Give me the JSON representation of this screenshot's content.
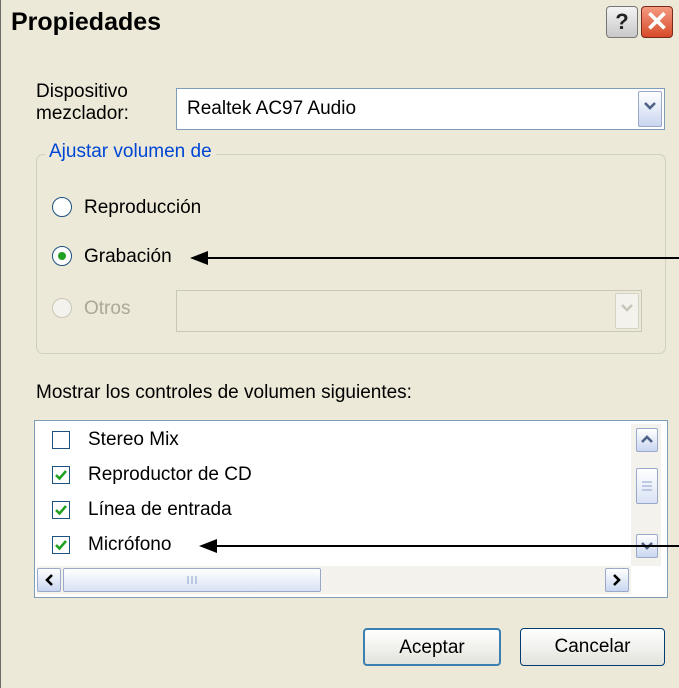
{
  "window": {
    "title": "Propiedades"
  },
  "titlebar": {
    "help_label": "?",
    "close_label": "✕"
  },
  "mixer": {
    "label": "Dispositivo\nmezclador:",
    "label_line1": "Dispositivo",
    "label_line2": "mezclador:",
    "selected": "Realtek AC97 Audio"
  },
  "volume_group": {
    "legend": "Ajustar volumen de",
    "options": [
      {
        "label": "Reproducción",
        "selected": false,
        "enabled": true
      },
      {
        "label": "Grabación",
        "selected": true,
        "enabled": true
      },
      {
        "label": "Otros",
        "selected": false,
        "enabled": false
      }
    ],
    "otros_combo_value": ""
  },
  "controls": {
    "heading": "Mostrar los controles de volumen siguientes:",
    "items": [
      {
        "label": "Stereo Mix",
        "checked": false
      },
      {
        "label": "Reproductor de CD",
        "checked": true
      },
      {
        "label": "Línea de entrada",
        "checked": true
      },
      {
        "label": "Micrófono",
        "checked": true
      }
    ]
  },
  "buttons": {
    "ok": "Aceptar",
    "cancel": "Cancelar"
  },
  "colors": {
    "window_bg": "#ece9d8",
    "legend_text": "#0046d5",
    "check_green": "#21a121",
    "close_red": "#d74a2a",
    "border_blue": "#7f9db9"
  },
  "icons": {
    "help": "help-icon",
    "close": "close-icon",
    "dropdown": "chevron-down-icon",
    "radio_dot": "radio-dot-icon",
    "check": "checkmark-icon",
    "scroll_up": "arrow-up-icon",
    "scroll_down": "arrow-down-icon",
    "scroll_left": "arrow-left-icon",
    "scroll_right": "arrow-right-icon",
    "annotation": "pointer-arrow-icon"
  }
}
